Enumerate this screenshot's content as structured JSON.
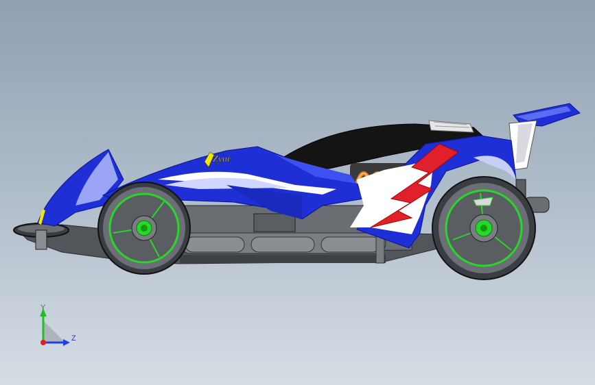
{
  "viewport": {
    "background_top": "#8fa0b3",
    "background_bottom": "#d6dde5"
  },
  "model": {
    "body_logo_text": "Zyur",
    "colors": {
      "body_blue": "#1f2fd6",
      "body_highlight": "#8fa0ff",
      "flame_red": "#e0202a",
      "white": "#ffffff",
      "chassis_gray": "#4a4d52",
      "canopy_black": "#141414",
      "spring_orange": "#e08020",
      "wheel_rim_green": "#29d629",
      "tire_dark": "#3a3d42"
    }
  },
  "triad": {
    "y_label": "Y",
    "z_label": "Z",
    "x_color": "#e02020",
    "y_color": "#20c020",
    "z_color": "#2040e0"
  }
}
